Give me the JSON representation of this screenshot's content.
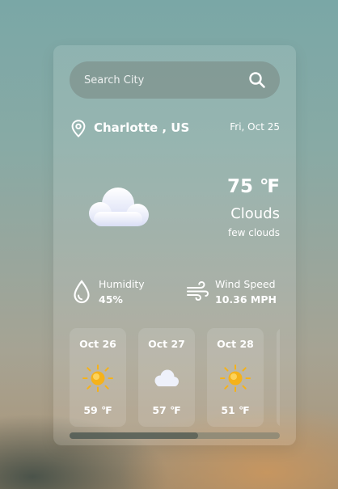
{
  "search": {
    "placeholder": "Search City",
    "icon": "search-icon"
  },
  "location": {
    "icon": "location-pin-icon",
    "city": "Charlotte , US",
    "date": "Fri, Oct 25"
  },
  "current": {
    "icon": "cloud-icon",
    "temperature": "75 ℉",
    "condition": "Clouds",
    "description": "few clouds"
  },
  "details": {
    "humidity": {
      "icon": "water-drop-icon",
      "label": "Humidity",
      "value": "45%"
    },
    "wind": {
      "icon": "wind-icon",
      "label": "Wind Speed",
      "value": "10.36 MPH"
    }
  },
  "forecast": [
    {
      "date": "Oct 26",
      "icon": "sun-icon",
      "temp": "59 ℉"
    },
    {
      "date": "Oct 27",
      "icon": "cloud-icon",
      "temp": "57 ℉"
    },
    {
      "date": "Oct 28",
      "icon": "sun-icon",
      "temp": "51 ℉"
    }
  ],
  "forecast_scroll": {
    "position_fraction": 0.0,
    "visible_fraction": 0.61
  },
  "colors": {
    "sun": "#f5b21a",
    "cloud": "#eef1fb",
    "text": "#ffffff"
  }
}
